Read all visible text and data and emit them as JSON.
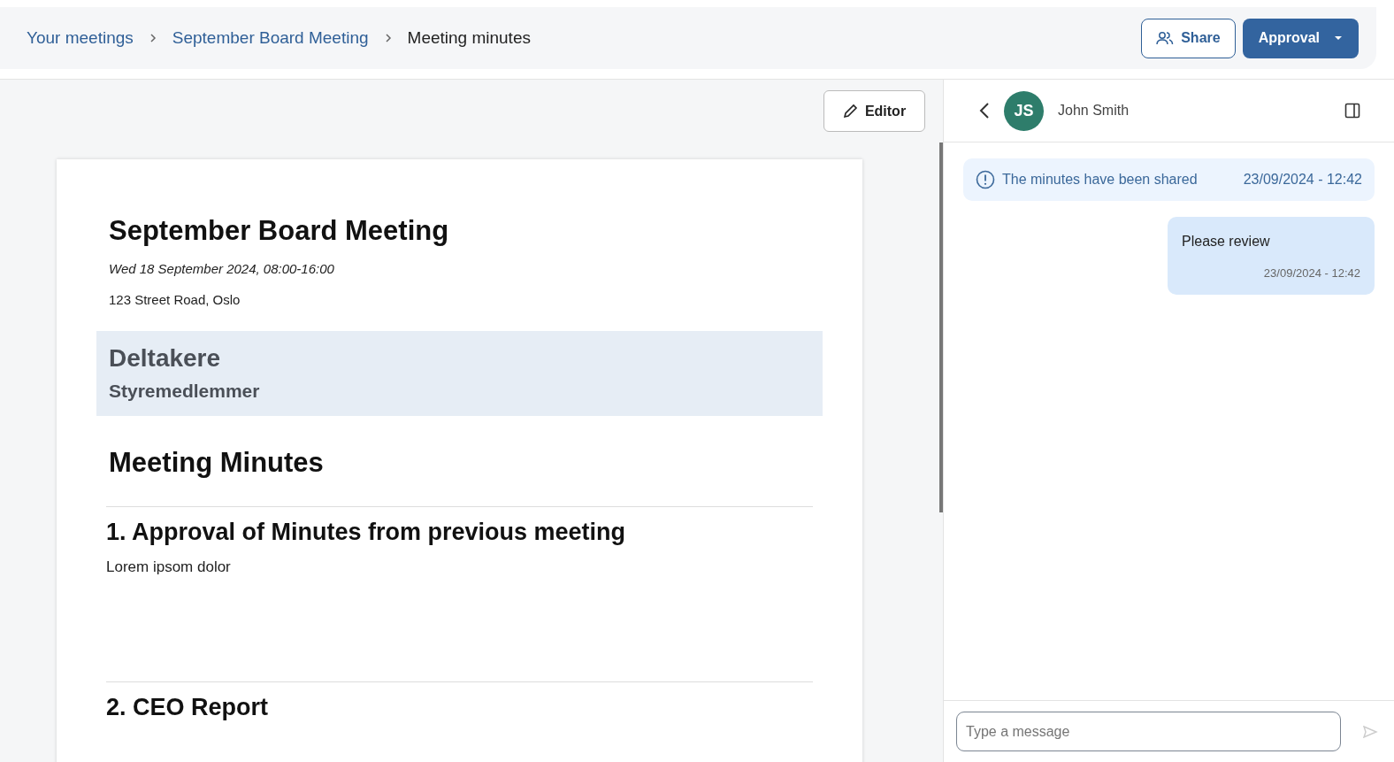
{
  "breadcrumbs": [
    {
      "label": "Your meetings",
      "current": false
    },
    {
      "label": "September Board Meeting",
      "current": false
    },
    {
      "label": "Meeting minutes",
      "current": true
    }
  ],
  "header_buttons": {
    "share": "Share",
    "approval": "Approval"
  },
  "editor_button": "Editor",
  "document": {
    "title": "September Board Meeting",
    "date": "Wed 18 September 2024, 08:00-16:00",
    "address": "123 Street Road, Oslo",
    "participants": {
      "heading": "Deltakere",
      "group": "Styremedlemmer"
    },
    "minutes_heading": "Meeting Minutes",
    "items": [
      {
        "title": "1. Approval of Minutes from previous meeting",
        "body": "Lorem ipsom dolor"
      },
      {
        "title": "2. CEO Report"
      }
    ]
  },
  "chat": {
    "contact": {
      "initials": "JS",
      "name": "John Smith"
    },
    "notice": {
      "text": "The minutes have been shared",
      "time": "23/09/2024 - 12:42"
    },
    "messages": [
      {
        "text": "Please review",
        "time": "23/09/2024 - 12:42"
      }
    ],
    "input": {
      "placeholder": "Type a message"
    }
  }
}
